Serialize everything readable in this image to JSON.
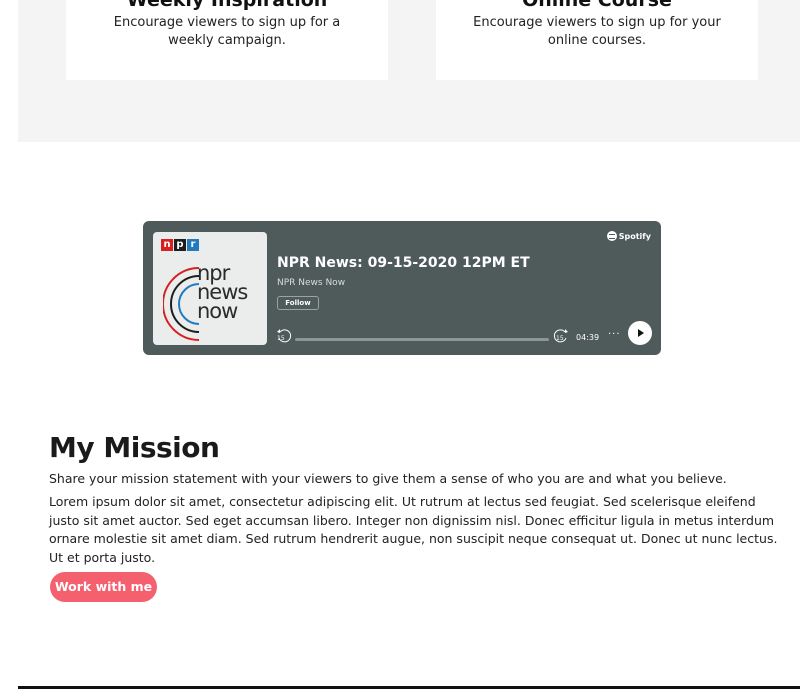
{
  "features": [
    {
      "title": "Weekly Inspiration",
      "description": "Encourage viewers to sign up for a weekly campaign."
    },
    {
      "title": "Online Course",
      "description": "Encourage viewers to sign up for your online courses."
    }
  ],
  "player": {
    "brand": "Spotify",
    "cover_logo": "npr",
    "cover_title_1": "npr",
    "cover_title_2": "news",
    "cover_title_3": "now",
    "episode_title": "NPR News: 09-15-2020 12PM ET",
    "show_name": "NPR News Now",
    "follow_label": "Follow",
    "skip_back_label": "15",
    "skip_forward_label": "15",
    "duration": "04:39",
    "more_label": "···",
    "progress": 0,
    "background_color": "#4f5a5b"
  },
  "mission": {
    "heading": "My Mission",
    "lead": "Share your mission statement with your viewers to give them a sense of who you are and what you believe.",
    "body": "Lorem ipsum dolor sit amet, consectetur adipiscing elit. Ut rutrum at lectus sed feugiat. Sed scelerisque eleifend justo sit amet auctor. Sed eget accumsan libero. Integer non dignissim nisl. Donec efficitur ligula in metus interdum ornare molestie sit amet diam. Sed rutrum hendrerit augue, non suscipit neque consequat ut. Donec ut nunc lectus. Ut et porta justo.",
    "cta_label": "Work with me",
    "cta_color": "#f4606e"
  }
}
